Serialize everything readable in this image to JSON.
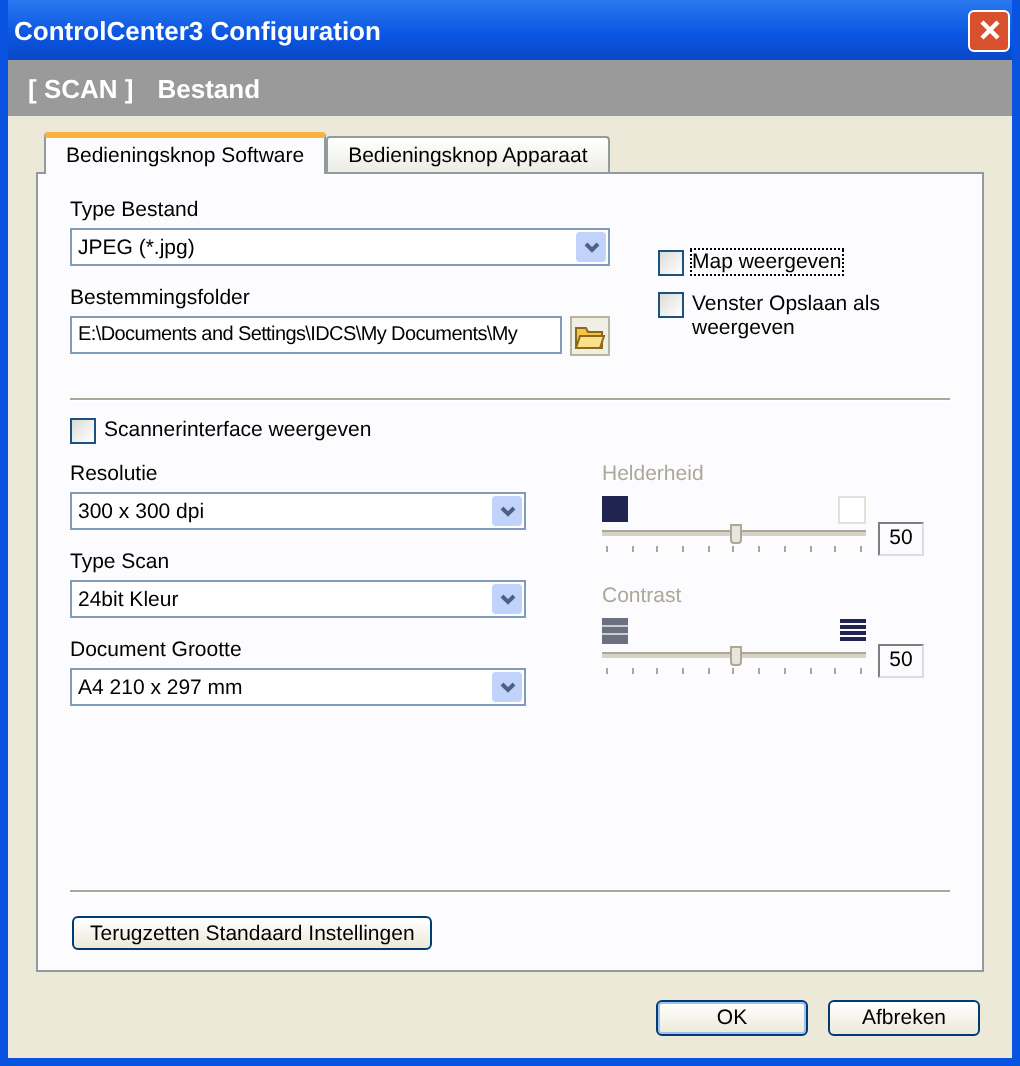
{
  "window": {
    "title": "ControlCenter3 Configuration"
  },
  "header": {
    "section": "[ SCAN ]",
    "name": "Bestand"
  },
  "tabs": [
    {
      "label": "Bedieningsknop Software",
      "selected": true
    },
    {
      "label": "Bedieningsknop Apparaat",
      "selected": false
    }
  ],
  "file_type": {
    "label": "Type Bestand",
    "value": "JPEG (*.jpg)"
  },
  "destination": {
    "label": "Bestemmingsfolder",
    "value": "E:\\Documents and Settings\\IDCS\\My Documents\\My"
  },
  "options": [
    {
      "label": "Map weergeven",
      "checked": false,
      "focused": true
    },
    {
      "label": "Venster Opslaan als weergeven",
      "checked": false,
      "focused": false
    }
  ],
  "scanner_interface": {
    "label": "Scannerinterface weergeven",
    "checked": false
  },
  "combos": [
    {
      "label": "Resolutie",
      "value": "300 x 300 dpi"
    },
    {
      "label": "Type Scan",
      "value": "24bit Kleur"
    },
    {
      "label": "Document Grootte",
      "value": "A4 210 x 297 mm"
    }
  ],
  "sliders": [
    {
      "kind": "brightness",
      "label": "Helderheid",
      "level": 0.5,
      "value": "50",
      "disabled": true
    },
    {
      "kind": "contrast",
      "label": "Contrast",
      "level": 0.5,
      "value": "50",
      "disabled": true
    }
  ],
  "reset_button": "Terugzetten Standaard Instellingen",
  "buttons": [
    "OK",
    "Afbreken"
  ]
}
